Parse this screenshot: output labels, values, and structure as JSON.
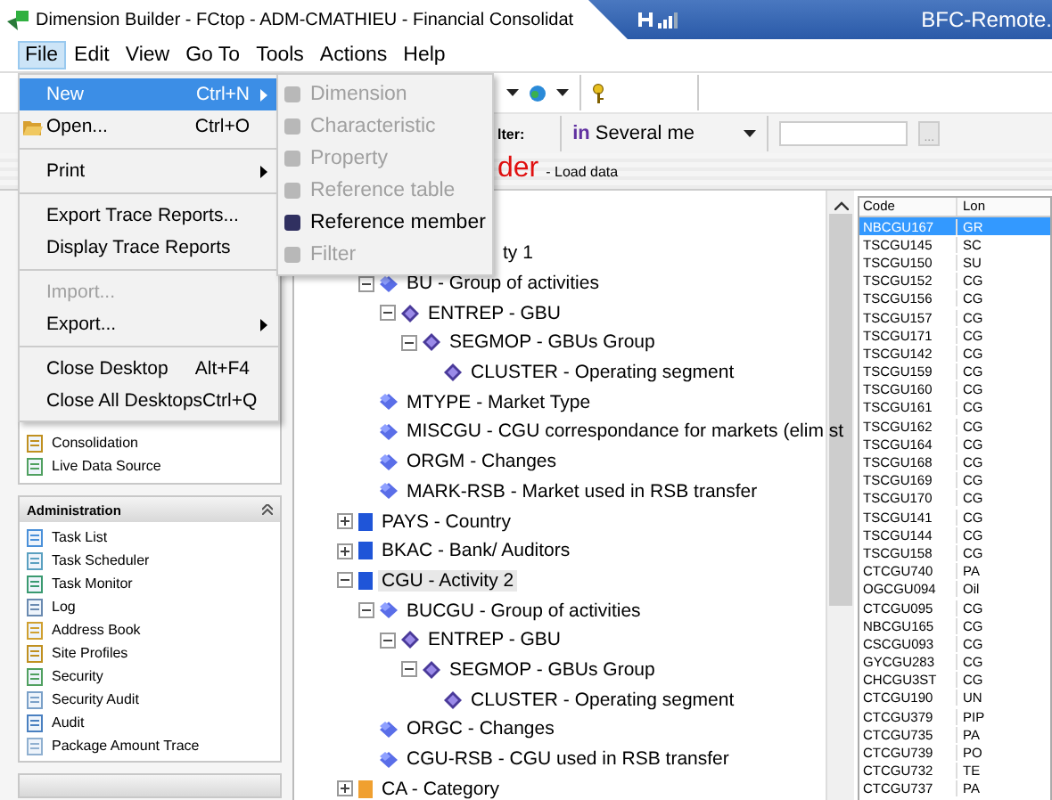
{
  "window": {
    "title": "Dimension Builder - FCtop - ADM-CMATHIEU - Financial Consolidat",
    "remote_title": "BFC-Remote."
  },
  "menubar": [
    {
      "label": "File",
      "selected": true
    },
    {
      "label": "Edit",
      "selected": false
    },
    {
      "label": "View",
      "selected": false
    },
    {
      "label": "Go To",
      "selected": false
    },
    {
      "label": "Tools",
      "selected": false
    },
    {
      "label": "Actions",
      "selected": false
    },
    {
      "label": "Help",
      "selected": false
    }
  ],
  "file_menu": [
    {
      "kind": "item",
      "label": "New",
      "shortcut": "Ctrl+N",
      "submenu": true,
      "selected": true,
      "disabled": false
    },
    {
      "kind": "icon-item",
      "label": "Open...",
      "shortcut": "Ctrl+O",
      "submenu": false,
      "selected": false,
      "disabled": false
    },
    {
      "kind": "separator"
    },
    {
      "kind": "item",
      "label": "Print",
      "submenu": true,
      "selected": false,
      "disabled": false
    },
    {
      "kind": "separator"
    },
    {
      "kind": "item",
      "label": "Export Trace Reports...",
      "submenu": false,
      "selected": false,
      "disabled": false
    },
    {
      "kind": "item",
      "label": "Display Trace Reports",
      "submenu": false,
      "selected": false,
      "disabled": false
    },
    {
      "kind": "separator"
    },
    {
      "kind": "item",
      "label": "Import...",
      "submenu": false,
      "selected": false,
      "disabled": true
    },
    {
      "kind": "item",
      "label": "Export...",
      "submenu": true,
      "selected": false,
      "disabled": false
    },
    {
      "kind": "separator"
    },
    {
      "kind": "item",
      "label": "Close Desktop",
      "shortcut": "Alt+F4",
      "submenu": false,
      "selected": false,
      "disabled": false
    },
    {
      "kind": "item",
      "label": "Close All Desktops",
      "shortcut": "Ctrl+Q",
      "submenu": false,
      "selected": false,
      "disabled": false
    }
  ],
  "new_submenu": [
    {
      "label": "Dimension",
      "disabled": true
    },
    {
      "label": "Characteristic",
      "disabled": true
    },
    {
      "label": "Property",
      "disabled": true
    },
    {
      "label": "Reference table",
      "disabled": true
    },
    {
      "label": "Reference member",
      "disabled": false
    },
    {
      "label": "Filter",
      "disabled": true
    }
  ],
  "filter": {
    "label": "lter:",
    "prefix": "in",
    "value": "Several me",
    "button": "..."
  },
  "header": {
    "title": "der",
    "subtitle": "- Load data"
  },
  "sidebar": {
    "panel_items": [
      "Consolidation",
      "Live Data Source"
    ],
    "admin": {
      "title": "Administration",
      "items": [
        "Task List",
        "Task Scheduler",
        "Task Monitor",
        "Log",
        "Address Book",
        "Site Profiles",
        "Security",
        "Security Audit",
        "Audit",
        "Package Amount Trace"
      ]
    }
  },
  "tree": [
    {
      "kind": "cut",
      "label": "ty 1",
      "selected": false,
      "expanded": true,
      "children": [
        {
          "kind": "member",
          "label": "BU - Group of activities",
          "selected": false,
          "expanded": true,
          "children": [
            {
              "kind": "level",
              "label": "ENTREP - GBU",
              "selected": false,
              "expanded": true,
              "children": [
                {
                  "kind": "level",
                  "label": "SEGMOP - GBUs Group",
                  "selected": false,
                  "expanded": true,
                  "children": [
                    {
                      "kind": "level",
                      "label": "CLUSTER - Operating segment",
                      "selected": false
                    }
                  ]
                }
              ]
            }
          ]
        },
        {
          "kind": "member",
          "label": "MTYPE - Market Type",
          "selected": false
        },
        {
          "kind": "member",
          "label": "MISCGU - CGU correspondance for markets (elim st",
          "selected": false
        },
        {
          "kind": "member",
          "label": "ORGM - Changes",
          "selected": false
        },
        {
          "kind": "member",
          "label": "MARK-RSB - Market used in RSB transfer",
          "selected": false
        }
      ]
    },
    {
      "kind": "dimension",
      "label": "PAYS - Country",
      "color": "#1f55d8",
      "selected": false,
      "expanded": false
    },
    {
      "kind": "dimension",
      "label": "BKAC - Bank/ Auditors",
      "color": "#1f55d8",
      "selected": false,
      "expanded": false
    },
    {
      "kind": "dimension",
      "label": "CGU - Activity 2",
      "color": "#1f55d8",
      "selected": true,
      "expanded": true,
      "children": [
        {
          "kind": "member",
          "label": "BUCGU - Group of activities",
          "selected": false,
          "expanded": true,
          "children": [
            {
              "kind": "level",
              "label": "ENTREP - GBU",
              "selected": false,
              "expanded": true,
              "children": [
                {
                  "kind": "level",
                  "label": "SEGMOP - GBUs Group",
                  "selected": false,
                  "expanded": true,
                  "children": [
                    {
                      "kind": "level",
                      "label": "CLUSTER - Operating segment",
                      "selected": false
                    }
                  ]
                }
              ]
            }
          ]
        },
        {
          "kind": "member",
          "label": "ORGC - Changes",
          "selected": false
        },
        {
          "kind": "member",
          "label": "CGU-RSB - CGU used in RSB transfer",
          "selected": false
        }
      ]
    },
    {
      "kind": "dimension",
      "label": "CA - Category",
      "color": "#f0a030",
      "selected": false,
      "expanded": false
    }
  ],
  "list": {
    "columns": [
      "Code",
      "Lon"
    ],
    "rows": [
      {
        "code": "NBCGU167",
        "column_2": "GR",
        "selected": true
      },
      {
        "code": "TSCGU145",
        "column_2": "SC",
        "selected": false
      },
      {
        "code": "TSCGU150",
        "column_2": "SU",
        "selected": false
      },
      {
        "code": "TSCGU152",
        "column_2": "CG",
        "selected": false
      },
      {
        "code": "TSCGU156",
        "column_2": "CG",
        "selected": false
      },
      {
        "code": "TSCGU157",
        "column_2": "CG",
        "selected": false
      },
      {
        "code": "TSCGU171",
        "column_2": "CG",
        "selected": false
      },
      {
        "code": "TSCGU142",
        "column_2": "CG",
        "selected": false
      },
      {
        "code": "TSCGU159",
        "column_2": "CG",
        "selected": false
      },
      {
        "code": "TSCGU160",
        "column_2": "CG",
        "selected": false
      },
      {
        "code": "TSCGU161",
        "column_2": "CG",
        "selected": false
      },
      {
        "code": "TSCGU162",
        "column_2": "CG",
        "selected": false
      },
      {
        "code": "TSCGU164",
        "column_2": "CG",
        "selected": false
      },
      {
        "code": "TSCGU168",
        "column_2": "CG",
        "selected": false
      },
      {
        "code": "TSCGU169",
        "column_2": "CG",
        "selected": false
      },
      {
        "code": "TSCGU170",
        "column_2": "CG",
        "selected": false
      },
      {
        "code": "TSCGU141",
        "column_2": "CG",
        "selected": false
      },
      {
        "code": "TSCGU144",
        "column_2": "CG",
        "selected": false
      },
      {
        "code": "TSCGU158",
        "column_2": "CG",
        "selected": false
      },
      {
        "code": "CTCGU740",
        "column_2": "PA",
        "selected": false
      },
      {
        "code": "OGCGU094",
        "column_2": "Oil",
        "selected": false
      },
      {
        "code": "CTCGU095",
        "column_2": "CG",
        "selected": false
      },
      {
        "code": "NBCGU165",
        "column_2": "CG",
        "selected": false
      },
      {
        "code": "CSCGU093",
        "column_2": "CG",
        "selected": false
      },
      {
        "code": "GYCGU283",
        "column_2": "CG",
        "selected": false
      },
      {
        "code": "CHCGU3ST",
        "column_2": "CG",
        "selected": false
      },
      {
        "code": "CTCGU190",
        "column_2": "UN",
        "selected": false
      },
      {
        "code": "CTCGU379",
        "column_2": "PIP",
        "selected": false
      },
      {
        "code": "CTCGU735",
        "column_2": "PA",
        "selected": false
      },
      {
        "code": "CTCGU739",
        "column_2": "PO",
        "selected": false
      },
      {
        "code": "CTCGU732",
        "column_2": "TE",
        "selected": false
      },
      {
        "code": "CTCGU737",
        "column_2": "PA",
        "selected": false
      }
    ]
  }
}
